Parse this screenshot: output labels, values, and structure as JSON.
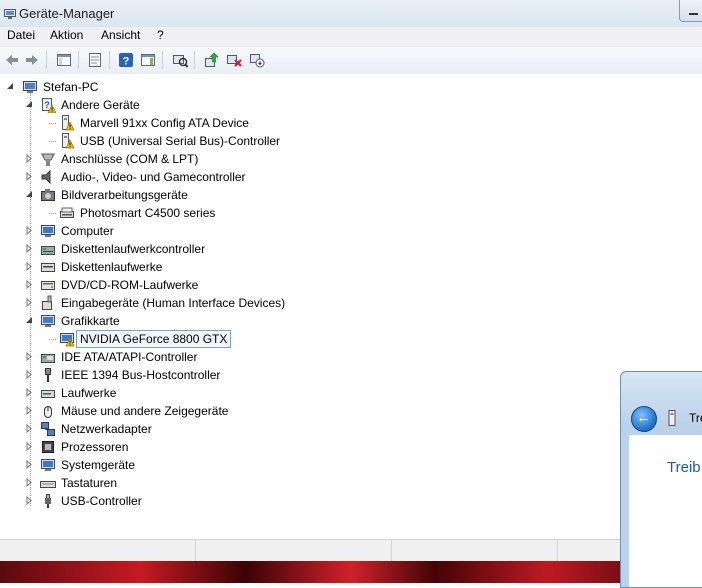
{
  "window": {
    "title": "Geräte-Manager"
  },
  "menu": [
    "Datei",
    "Aktion",
    "Ansicht",
    "?"
  ],
  "toolbar": {
    "buttons": [
      "back-icon",
      "forward-icon",
      "console-tree-icon",
      "properties-sheet-icon",
      "help-icon",
      "action-pane-icon",
      "scan-hardware-icon",
      "update-driver-icon",
      "uninstall-icon",
      "disable-icon"
    ]
  },
  "tree": {
    "root": "Stefan-PC",
    "items": [
      {
        "label": "Andere Geräte",
        "icon": "unknown-device-icon",
        "expanded": true,
        "children": [
          {
            "label": "Marvell 91xx Config ATA Device",
            "icon": "warning-device-icon"
          },
          {
            "label": "USB (Universal Serial Bus)-Controller",
            "icon": "warning-device-icon"
          }
        ]
      },
      {
        "label": "Anschlüsse (COM & LPT)",
        "icon": "port-icon"
      },
      {
        "label": "Audio-, Video- und Gamecontroller",
        "icon": "speaker-icon"
      },
      {
        "label": "Bildverarbeitungsgeräte",
        "icon": "camera-icon",
        "expanded": true,
        "children": [
          {
            "label": "Photosmart C4500 series",
            "icon": "scanner-icon"
          }
        ]
      },
      {
        "label": "Computer",
        "icon": "computer-icon"
      },
      {
        "label": "Diskettenlaufwerkcontroller",
        "icon": "floppy-controller-icon"
      },
      {
        "label": "Diskettenlaufwerke",
        "icon": "floppy-drive-icon"
      },
      {
        "label": "DVD/CD-ROM-Laufwerke",
        "icon": "dvd-drive-icon"
      },
      {
        "label": "Eingabegeräte (Human Interface Devices)",
        "icon": "hid-icon"
      },
      {
        "label": "Grafikkarte",
        "icon": "display-adapter-icon",
        "expanded": true,
        "children": [
          {
            "label": "NVIDIA GeForce 8800 GTX",
            "icon": "warning-display-icon",
            "selected": true
          }
        ]
      },
      {
        "label": "IDE ATA/ATAPI-Controller",
        "icon": "ide-controller-icon"
      },
      {
        "label": "IEEE 1394 Bus-Hostcontroller",
        "icon": "firewire-icon"
      },
      {
        "label": "Laufwerke",
        "icon": "disk-drive-icon"
      },
      {
        "label": "Mäuse und andere Zeigegeräte",
        "icon": "mouse-icon"
      },
      {
        "label": "Netzwerkadapter",
        "icon": "network-icon"
      },
      {
        "label": "Prozessoren",
        "icon": "processor-icon"
      },
      {
        "label": "Systemgeräte",
        "icon": "system-devices-icon"
      },
      {
        "label": "Tastaturen",
        "icon": "keyboard-icon"
      },
      {
        "label": "USB-Controller",
        "icon": "usb-icon"
      }
    ]
  },
  "dialog": {
    "title": "Tre",
    "heading": "Treib"
  },
  "colors": {
    "accent": "#1e5aa8",
    "warning": "#f5c211",
    "selection_border": "#7da2ce"
  }
}
